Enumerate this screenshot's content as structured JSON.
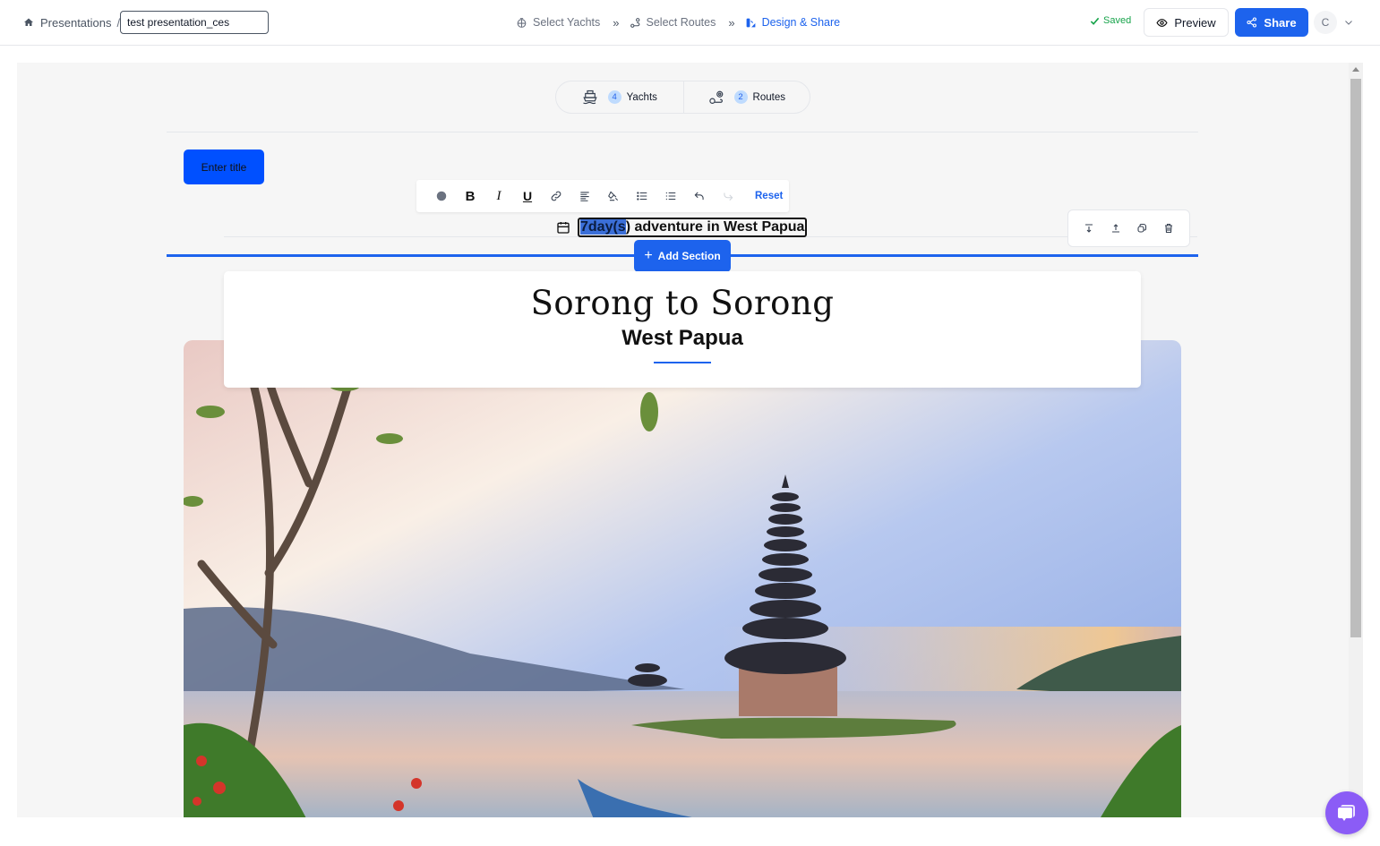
{
  "header": {
    "breadcrumb_root": "Presentations",
    "breadcrumb_sep": "/",
    "presentation_name": "test presentation_ces",
    "steps": [
      {
        "label": "Select Yachts",
        "icon": "yacht-wheel-icon",
        "active": false
      },
      {
        "label": "Select Routes",
        "icon": "route-icon",
        "active": false
      },
      {
        "label": "Design & Share",
        "icon": "design-icon",
        "active": true
      }
    ],
    "step_separator": "»",
    "saved_label": "Saved",
    "preview_label": "Preview",
    "share_label": "Share",
    "avatar_initial": "C"
  },
  "counts": {
    "yachts": {
      "count": "4",
      "label": "Yachts"
    },
    "routes": {
      "count": "2",
      "label": "Routes"
    }
  },
  "editor": {
    "enter_title_label": "Enter title",
    "toolbar": {
      "items": [
        "color",
        "bold",
        "italic",
        "underline",
        "link",
        "align",
        "clear-format",
        "bullet-list",
        "numbered-list",
        "undo",
        "redo"
      ],
      "bold_glyph": "B",
      "italic_glyph": "I",
      "underline_glyph": "U",
      "reset_label": "Reset"
    },
    "day_title_selected": "7day(s",
    "day_title_rest": ") adventure in West Papua",
    "add_section_label": "Add Section"
  },
  "route_card": {
    "title": "Sorong to Sorong",
    "subtitle": "West Papua"
  },
  "colors": {
    "accent": "#1d63ed",
    "saved": "#16a34a",
    "chat": "#8b5cf6"
  }
}
